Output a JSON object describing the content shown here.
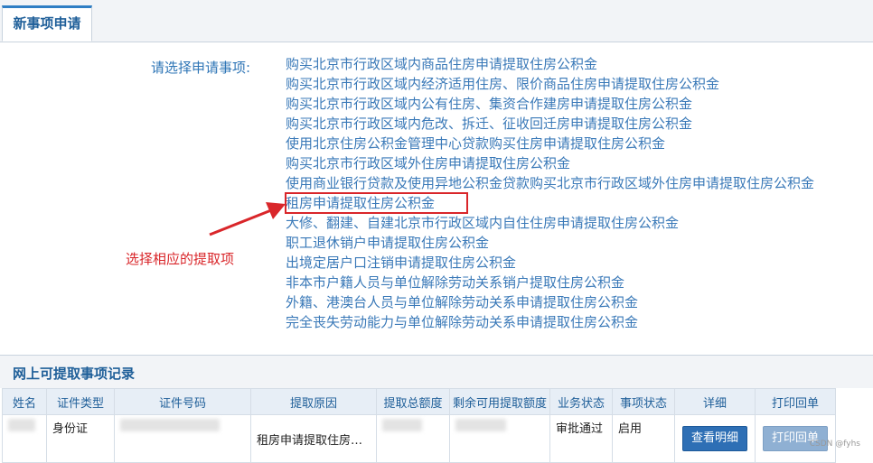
{
  "tab": {
    "label": "新事项申请"
  },
  "form": {
    "prompt": "请选择申请事项:",
    "options": [
      "购买北京市行政区域内商品住房申请提取住房公积金",
      "购买北京市行政区域内经济适用住房、限价商品住房申请提取住房公积金",
      "购买北京市行政区域内公有住房、集资合作建房申请提取住房公积金",
      "购买北京市行政区域内危改、拆迁、征收回迁房申请提取住房公积金",
      "使用北京住房公积金管理中心贷款购买住房申请提取住房公积金",
      "购买北京市行政区域外住房申请提取住房公积金",
      "使用商业银行贷款及使用异地公积金贷款购买北京市行政区域外住房申请提取住房公积金",
      "租房申请提取住房公积金",
      "大修、翻建、自建北京市行政区域内自住住房申请提取住房公积金",
      "职工退休销户申请提取住房公积金",
      "出境定居户口注销申请提取住房公积金",
      "非本市户籍人员与单位解除劳动关系销户提取住房公积金",
      "外籍、港澳台人员与单位解除劳动关系申请提取住房公积金",
      "完全丧失劳动能力与单位解除劳动关系申请提取住房公积金"
    ],
    "highlighted_index": 7,
    "annotation": "选择相应的提取项"
  },
  "records": {
    "title": "网上可提取事项记录",
    "columns": [
      "姓名",
      "证件类型",
      "证件号码",
      "提取原因",
      "提取总额度",
      "剩余可用提取额度",
      "业务状态",
      "事项状态",
      "详细",
      "打印回单"
    ],
    "row": {
      "id_type": "身份证",
      "reason": "租房申请提取住房公…",
      "biz_status": "审批通过",
      "item_status": "启用",
      "detail_btn": "查看明细",
      "print_btn": "打印回单"
    }
  },
  "watermark": "CSDN @fyhs",
  "colors": {
    "accent": "#2e75b6",
    "highlight": "#d9262a"
  }
}
